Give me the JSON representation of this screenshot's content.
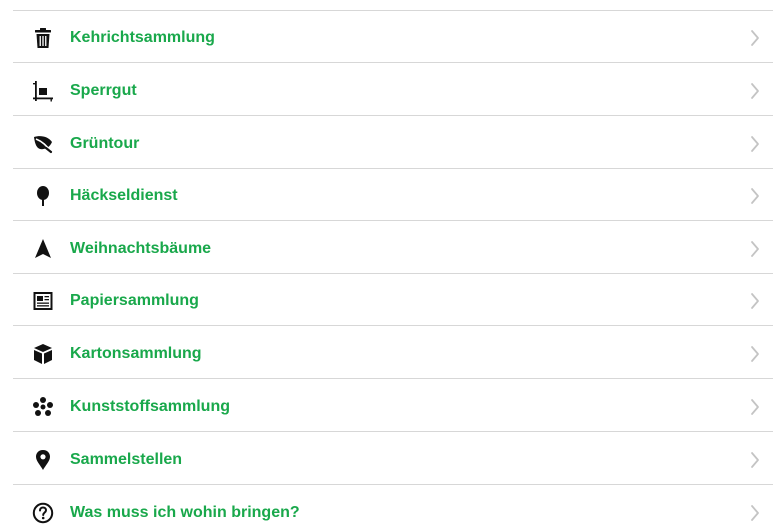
{
  "colors": {
    "accent": "#19a84b",
    "icon": "#111111",
    "chevron": "#c4c4c4",
    "divider": "#d7d7d7"
  },
  "menu": {
    "items": [
      {
        "label": "Kehrichtsammlung",
        "icon": "trash-icon"
      },
      {
        "label": "Sperrgut",
        "icon": "bulky-item-icon"
      },
      {
        "label": "Grüntour",
        "icon": "leaf-icon"
      },
      {
        "label": "Häckseldienst",
        "icon": "tree-icon"
      },
      {
        "label": "Weihnachtsbäume",
        "icon": "christmas-tree-icon"
      },
      {
        "label": "Papiersammlung",
        "icon": "newspaper-icon"
      },
      {
        "label": "Kartonsammlung",
        "icon": "box-icon"
      },
      {
        "label": "Kunststoffsammlung",
        "icon": "plastic-icon"
      },
      {
        "label": "Sammelstellen",
        "icon": "location-pin-icon"
      },
      {
        "label": "Was muss ich wohin bringen?",
        "icon": "question-icon"
      }
    ]
  }
}
